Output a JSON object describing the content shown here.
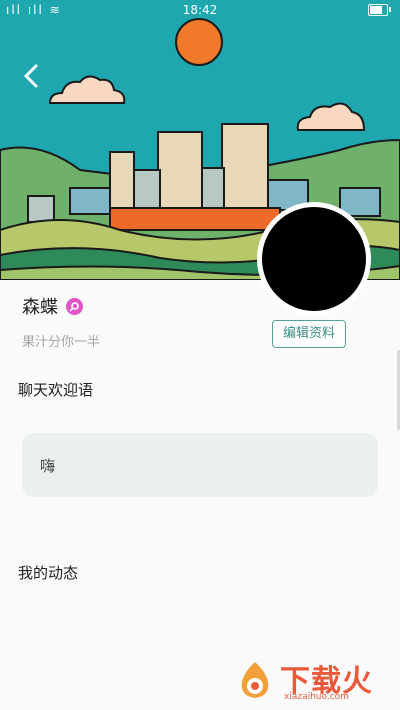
{
  "status_bar": {
    "left_icons": "ıll ıll ≋",
    "time": "18:42",
    "battery_level": 0.85
  },
  "header": {
    "back_icon": "chevron-left-icon"
  },
  "profile": {
    "name": "森蝶",
    "badge_icon": "search-icon",
    "signature": "果汁分你一半",
    "edit_label": "编辑资料"
  },
  "greeting": {
    "title": "聊天欢迎语",
    "text": "嗨"
  },
  "moments": {
    "title": "我的动态"
  },
  "watermark": {
    "text": "下载火",
    "sub": "xiazaihuo.com"
  },
  "colors": {
    "sky": "#1fa7b0",
    "sun": "#f07a2a",
    "accent": "#3f8d84",
    "badge": "#e255c8"
  }
}
